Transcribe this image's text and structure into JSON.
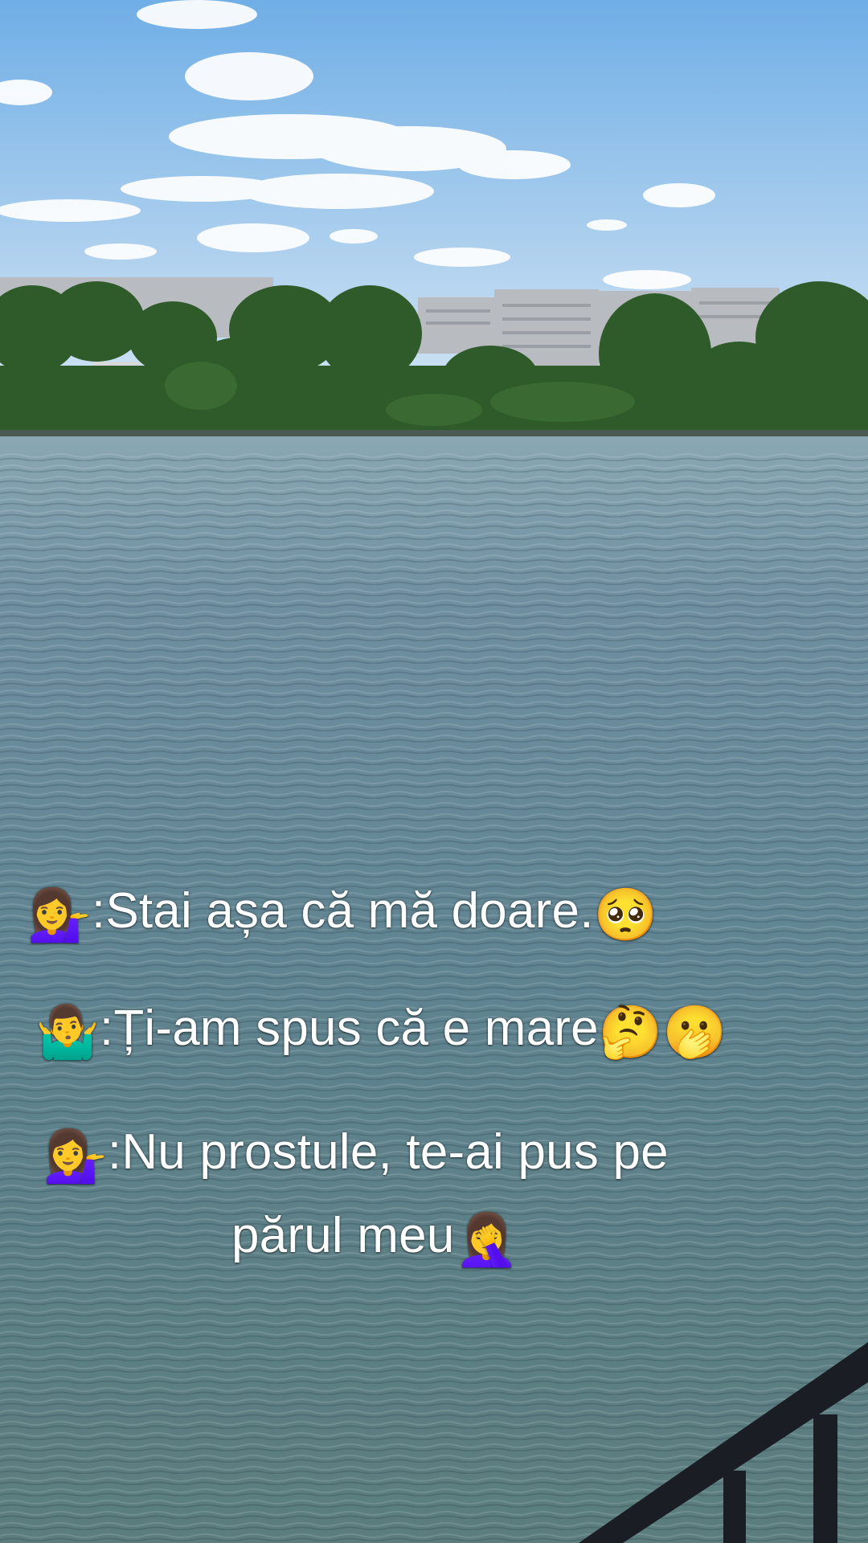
{
  "captions": {
    "line1": {
      "lead_emoji": "💁‍♀️",
      "text": ":Stai așa că mă doare.",
      "trail_emoji": "🥺"
    },
    "line2": {
      "lead_emoji": "🤷‍♂️",
      "text": ":Ți-am spus că e mare",
      "trail_emoji": "🤔🫢"
    },
    "line3": {
      "lead_emoji": "💁‍♀️",
      "text": ":Nu prostule, te-ai pus pe"
    },
    "line4": {
      "text": "părul meu",
      "trail_emoji": "🤦‍♀️"
    }
  },
  "scene": {
    "description_icons": [
      "cloud-icon",
      "tree-icon",
      "building-icon",
      "railing-icon"
    ],
    "colors": {
      "sky_top": "#7ab4e6",
      "sky_bottom": "#d9e9f6",
      "water": "#5c7f88",
      "trees": "#2f5a2a",
      "buildings": "#b9bcbf",
      "railing": "#1b1e24"
    }
  }
}
